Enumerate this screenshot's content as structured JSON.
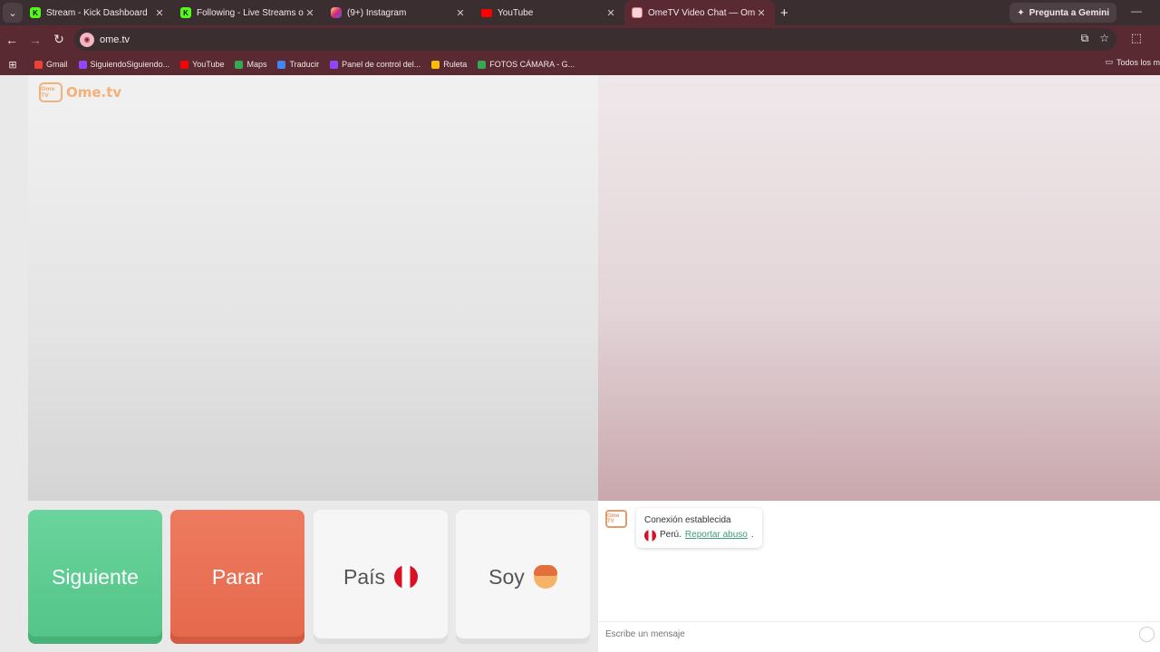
{
  "browser": {
    "tabs": [
      {
        "title": "Stream - Kick Dashboard",
        "icon": "kick",
        "active": false
      },
      {
        "title": "Following - Live Streams on Kic",
        "icon": "kick",
        "active": false
      },
      {
        "title": "(9+) Instagram",
        "icon": "instagram",
        "active": false
      },
      {
        "title": "YouTube",
        "icon": "youtube",
        "active": false
      },
      {
        "title": "OmeTV Video Chat — Ome",
        "icon": "ometv",
        "active": true
      }
    ],
    "new_tab": "+",
    "gemini_label": "Pregunta a Gemini",
    "url": "ome.tv",
    "bookmarks": [
      {
        "label": "Gmail",
        "color": "#ea4335"
      },
      {
        "label": "SiguiendoSiguiendo...",
        "color": "#9146ff"
      },
      {
        "label": "YouTube",
        "color": "#ff0000"
      },
      {
        "label": "Maps",
        "color": "#34a853"
      },
      {
        "label": "Traducir",
        "color": "#4285f4"
      },
      {
        "label": "Panel de control del...",
        "color": "#9146ff"
      },
      {
        "label": "Ruleta",
        "color": "#fbbc05"
      },
      {
        "label": "FOTOS CÁMARA - G...",
        "color": "#34a853"
      }
    ],
    "all_bookmarks": "Todos los m"
  },
  "ometv": {
    "logo_text": "Ome.tv",
    "logo_badge": "Ome TV",
    "buttons": {
      "next": "Siguiente",
      "stop": "Parar",
      "country": "País",
      "iam": "Soy"
    },
    "chat": {
      "status": "Conexión establecida",
      "country": "Perú.",
      "report": "Reportar abuso",
      "report_suffix": ".",
      "input_placeholder": "Escribe un mensaje"
    }
  },
  "colors": {
    "next": "#5fcc91",
    "stop": "#ea7257",
    "tab_active": "#5a2a33",
    "link": "#3b9e74"
  }
}
